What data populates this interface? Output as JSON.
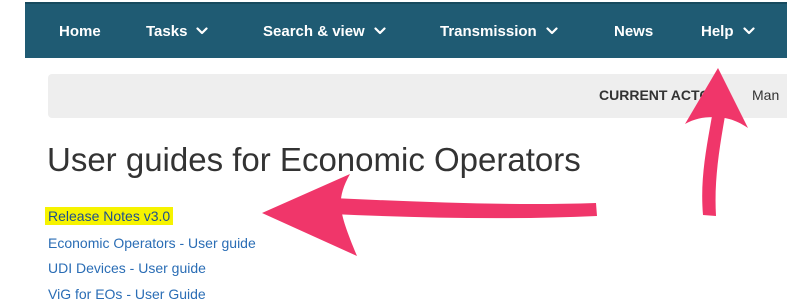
{
  "nav": {
    "items": [
      {
        "label": "Home",
        "has_dropdown": false
      },
      {
        "label": "Tasks",
        "has_dropdown": true
      },
      {
        "label": "Search & view",
        "has_dropdown": true
      },
      {
        "label": "Transmission",
        "has_dropdown": true
      },
      {
        "label": "News",
        "has_dropdown": false
      },
      {
        "label": "Help",
        "has_dropdown": true
      }
    ]
  },
  "actor": {
    "label": "CURRENT ACTOR:",
    "value": "Man"
  },
  "page": {
    "title": "User guides for Economic Operators"
  },
  "guides": [
    {
      "label": "Release Notes v3.0",
      "highlighted": true
    },
    {
      "label": "Economic Operators - User guide",
      "highlighted": false
    },
    {
      "label": "UDI Devices - User guide",
      "highlighted": false
    },
    {
      "label": "ViG for EOs - User Guide",
      "highlighted": false
    }
  ],
  "colors": {
    "navbar": "#1f5b73",
    "link": "#2a6db5",
    "highlight": "#f6f300",
    "annotation_arrow": "#f0366a"
  }
}
